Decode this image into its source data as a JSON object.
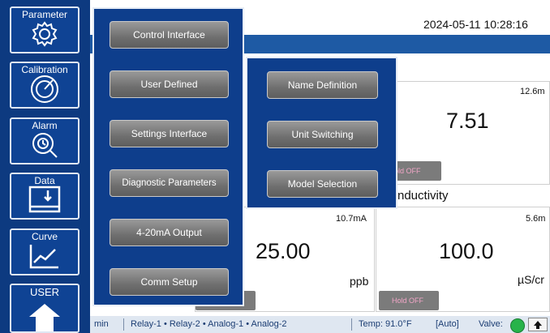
{
  "header": {
    "datetime": "2024-05-11 10:28:16"
  },
  "sidebar": {
    "items": [
      {
        "label": "Parameter",
        "icon": "gear-icon"
      },
      {
        "label": "Calibration",
        "icon": "calibration-dial-icon"
      },
      {
        "label": "Alarm",
        "icon": "alarm-magnifier-icon"
      },
      {
        "label": "Data",
        "icon": "data-download-icon"
      },
      {
        "label": "Curve",
        "icon": "curve-chart-icon"
      },
      {
        "label": "USER",
        "icon": "home-icon"
      }
    ]
  },
  "parameter_menu": {
    "items": [
      "Control Interface",
      "User Defined",
      "Settings Interface",
      "Diagnostic Parameters",
      "4-20mA Output",
      "Comm Setup"
    ]
  },
  "user_defined_submenu": {
    "items": [
      "Name Definition",
      "Unit Switching",
      "Model Selection"
    ]
  },
  "panels": {
    "top_right": {
      "current": "12.6m",
      "value": "7.51",
      "hold": "old OFF"
    },
    "middle_label": "nductivity",
    "bottom_left": {
      "current": "10.7mA",
      "value": "25.00",
      "unit": "ppb"
    },
    "bottom_right": {
      "current": "5.6m",
      "value": "100.0",
      "unit": "µS/cr",
      "hold": "Hold OFF"
    }
  },
  "statusbar": {
    "min": "min",
    "relays": "Relay-1  •  Relay-2  •  Analog-1  •  Analog-2",
    "temp": "Temp:  91.0°F",
    "mode": "[Auto]",
    "valve": "Valve:",
    "valve_color": "#27b34a"
  },
  "colors": {
    "nav_bg": "#0d3a80",
    "menu_bg": "#0e3e8c",
    "title_bar": "#1e5aa4"
  }
}
